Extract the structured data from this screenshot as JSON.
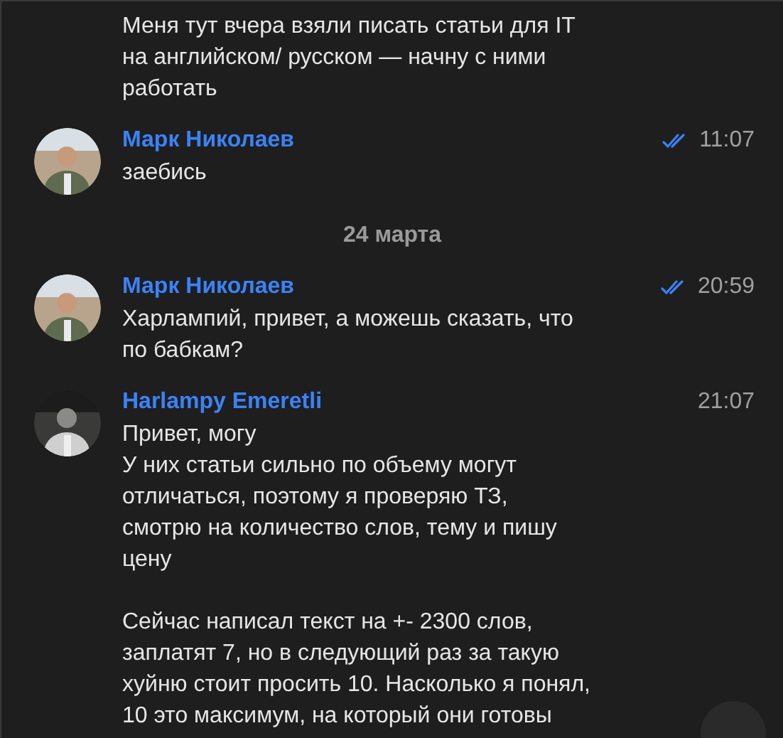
{
  "items": [
    {
      "kind": "message",
      "text": "Меня тут вчера взяли писать статьи для IT\nна английском/ русском — начну с ними\nработать"
    },
    {
      "kind": "message",
      "author": "Марк Николаев",
      "time": "11:07",
      "read": true,
      "text": "заебись"
    },
    {
      "kind": "date",
      "text": "24 марта"
    },
    {
      "kind": "message",
      "author": "Марк Николаев",
      "time": "20:59",
      "read": true,
      "text": "Харлампий, привет, а можешь сказать, что\nпо бабкам?"
    },
    {
      "kind": "message",
      "author": "Harlampy Emeretli",
      "time": "21:07",
      "read": false,
      "text": "Привет, могу\nУ них статьи сильно по объему могут\nотличаться, поэтому я проверяю ТЗ,\nсмотрю на количество слов, тему и пишу\nцену\n\nСейчас написал текст на +- 2300 слов,\nзаплатят 7, но в следующий раз за такую\nхуйню стоит просить 10. Насколько я понял,\n10 это максимум, на который они готовы"
    }
  ]
}
